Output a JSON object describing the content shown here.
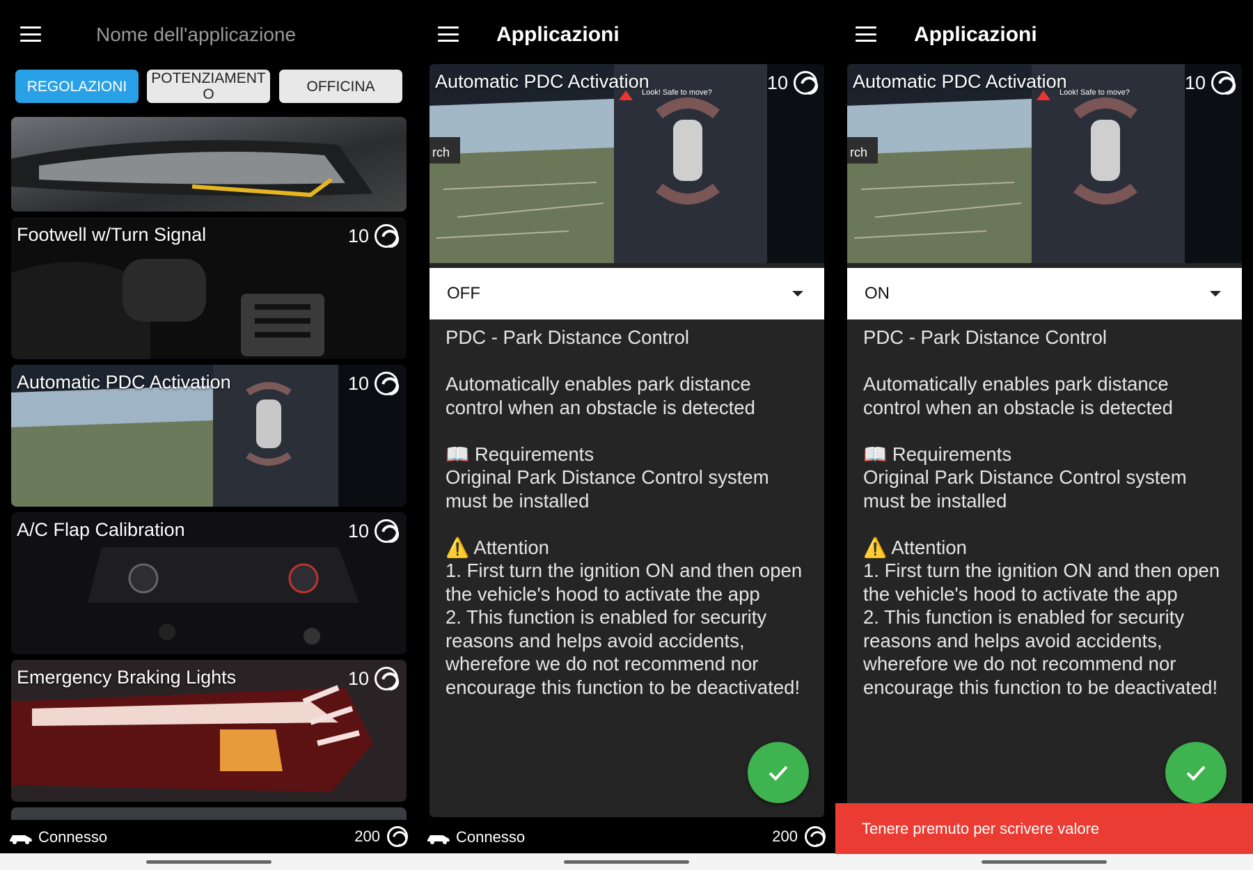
{
  "panel1": {
    "title": "Nome dell'applicazione",
    "tabs": [
      {
        "label": "REGOLAZIONI",
        "active": true
      },
      {
        "label": "POTENZIAMENTO",
        "active": false
      },
      {
        "label": "OFFICINA",
        "active": false
      }
    ],
    "cards": [
      {
        "title": "",
        "cost": ""
      },
      {
        "title": "Footwell w/Turn Signal",
        "cost": "10"
      },
      {
        "title": "Automatic PDC Activation",
        "cost": "10"
      },
      {
        "title": "A/C Flap Calibration",
        "cost": "10"
      },
      {
        "title": "Emergency Braking Lights",
        "cost": "10"
      }
    ],
    "footer": {
      "status": "Connesso",
      "credits": "200"
    }
  },
  "panel2": {
    "title": "Applicazioni",
    "app_name": "Automatic PDC Activation",
    "cost": "10",
    "dropdown_value": "OFF",
    "footer": {
      "status": "Connesso",
      "credits": "200"
    }
  },
  "panel3": {
    "title": "Applicazioni",
    "app_name": "Automatic PDC Activation",
    "cost": "10",
    "dropdown_value": "ON",
    "snackbar": "Tenere premuto per scrivere valore"
  },
  "description": {
    "heading": "PDC - Park Distance Control",
    "summary": "Automatically enables park distance\ncontrol when an obstacle is detected",
    "requirements_label": "📖 Requirements",
    "requirements_text": "Original Park Distance Control system\nmust be installed",
    "attention_label": "⚠️ Attention",
    "attention_text": "1. First turn the ignition ON and then open\nthe vehicle's hood to activate the app\n2. This function is enabled for security\nreasons and helps avoid accidents,\nwherefore we do not recommend nor\nencourage this function to be deactivated!"
  },
  "screen_labels": {
    "pdc_warning": "Look! Safe to move?",
    "truncated_label": "rch"
  },
  "colors": {
    "accent": "#2aa1e6",
    "confirm": "#3fb34f",
    "snackbar": "#ea3c33",
    "card": "#252525"
  },
  "icons": [
    "menu-icon",
    "coin-icon",
    "car-icon",
    "check-icon",
    "dropdown-caret-icon"
  ]
}
